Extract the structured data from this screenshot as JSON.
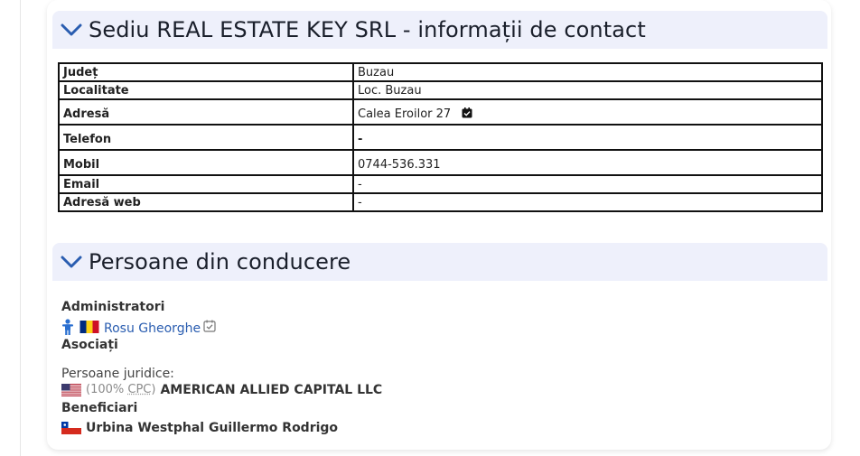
{
  "contact_section": {
    "title": "Sediu REAL ESTATE KEY SRL - informații de contact",
    "rows": [
      {
        "label": "Județ",
        "value": "Buzau"
      },
      {
        "label": "Localitate",
        "value": "Loc. Buzau"
      },
      {
        "label": "Adresă",
        "value": "Calea Eroilor 27"
      },
      {
        "label": "Telefon",
        "value": "-"
      },
      {
        "label": "Mobil",
        "value": "0744-536.331"
      },
      {
        "label": "Email",
        "value": "-"
      },
      {
        "label": "Adresă web",
        "value": "-"
      }
    ]
  },
  "management_section": {
    "title": "Persoane din conducere",
    "administrators_label": "Administratori",
    "administrator_name": "Rosu Gheorghe",
    "associates_label": "Asociați",
    "legal_persons_label": "Persoane juridice:",
    "legal_person_share_open": "(100% ",
    "legal_person_share_abbr": "CPC",
    "legal_person_share_close": ")",
    "legal_person_name": "AMERICAN ALLIED CAPITAL LLC",
    "beneficiaries_label": "Beneficiari",
    "beneficiary_name": "Urbina Westphal Guillermo Rodrigo"
  },
  "colors": {
    "header_bg": "#eef0fb",
    "chevron": "#2a5db0",
    "link": "#2a5db0"
  },
  "icons": [
    "chevron-down-icon",
    "verified-icon",
    "person-icon",
    "flag-romania-icon",
    "flag-usa-icon",
    "flag-chile-icon"
  ]
}
